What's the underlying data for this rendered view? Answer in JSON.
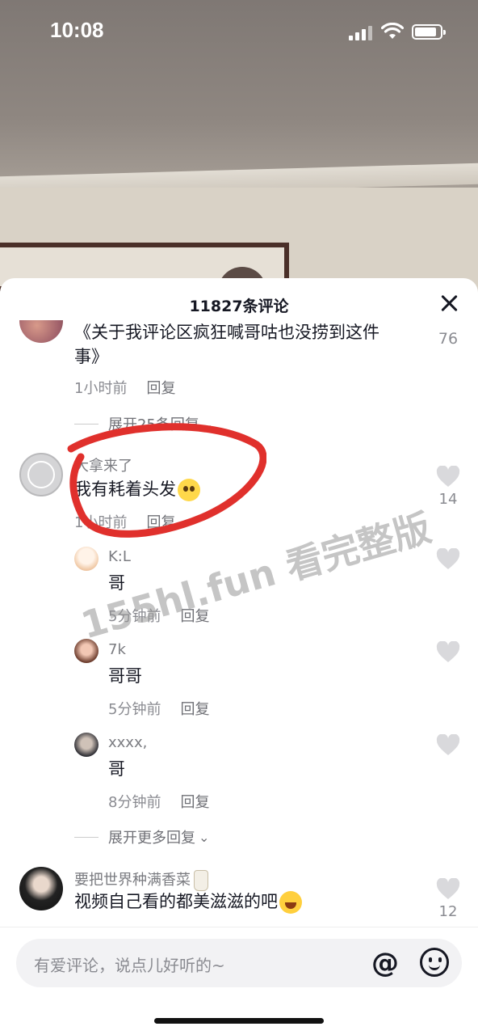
{
  "status_bar": {
    "time": "10:08"
  },
  "sheet": {
    "title": "11827条评论"
  },
  "comments": [
    {
      "text_line1": "《关于我评论区疯狂喊哥咕也没捞到这件",
      "text_line2": "事》",
      "time": "1小时前",
      "reply_label": "回复",
      "likes": "76",
      "expand_label": "展开25条回复"
    },
    {
      "username": "大拿来了",
      "text": "我有耗着头发",
      "time": "1小时前",
      "reply_label": "回复",
      "likes": "14",
      "replies": [
        {
          "username": "K:L",
          "text": "哥",
          "time": "5分钟前",
          "reply_label": "回复"
        },
        {
          "username": "7k",
          "text": "哥哥",
          "time": "5分钟前",
          "reply_label": "回复"
        },
        {
          "username": "xxxx,",
          "text": "哥",
          "time": "8分钟前",
          "reply_label": "回复"
        }
      ],
      "expand_label": "展开更多回复"
    },
    {
      "username": "要把世界种满香菜",
      "text": "视频自己看的都美滋滋的吧",
      "likes": "12"
    }
  ],
  "watermark": "155hl.fun 看完整版",
  "input": {
    "placeholder": "有爱评论，说点儿好听的~"
  },
  "icons": {
    "at": "@",
    "colors": {
      "heart": "#d9d9dc",
      "annotation": "#e0302c"
    }
  }
}
